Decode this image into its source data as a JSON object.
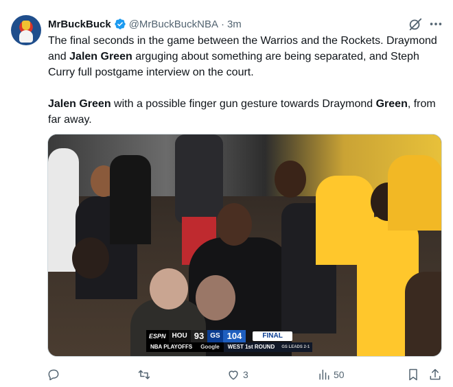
{
  "tweet": {
    "display_name": "MrBuckBuck",
    "handle": "@MrBuckBuckNBA",
    "separator": "·",
    "time": "3m",
    "text_line1": "The final seconds in the game between the Warrios and the Rockets. Draymond and ",
    "text_bold1": "Jalen Green",
    "text_line1b": " arguging about something are being separated, and Steph Curry full postgame interview on the court.",
    "text_bold2": "Jalen Green",
    "text_line2": " with a possible finger gun gesture towards Draymond ",
    "text_bold3": "Green",
    "text_line2b": ", from far away."
  },
  "scorebug": {
    "network": "ESPN",
    "away_team": "HOU",
    "away_score": "93",
    "home_team": "GS",
    "home_score": "104",
    "status": "FINAL",
    "event": "NBA PLAYOFFS",
    "sponsor": "Google",
    "round": "WEST 1st ROUND",
    "series": "GS LEADS 2-1"
  },
  "actions": {
    "reply_count": "",
    "retweet_count": "",
    "like_count": "3",
    "views_count": "50"
  },
  "icons": {
    "verified": "verified-badge-icon",
    "grok": "grok-icon",
    "more": "more-icon",
    "reply": "reply-icon",
    "retweet": "retweet-icon",
    "like": "heart-icon",
    "views": "views-icon",
    "bookmark": "bookmark-icon",
    "share": "share-icon"
  },
  "colors": {
    "verified_blue": "#1d9bf0",
    "muted_text": "#536471",
    "rockets_red": "#ce1141",
    "warriors_gold": "#ffc72c",
    "warriors_blue": "#1d428a"
  }
}
